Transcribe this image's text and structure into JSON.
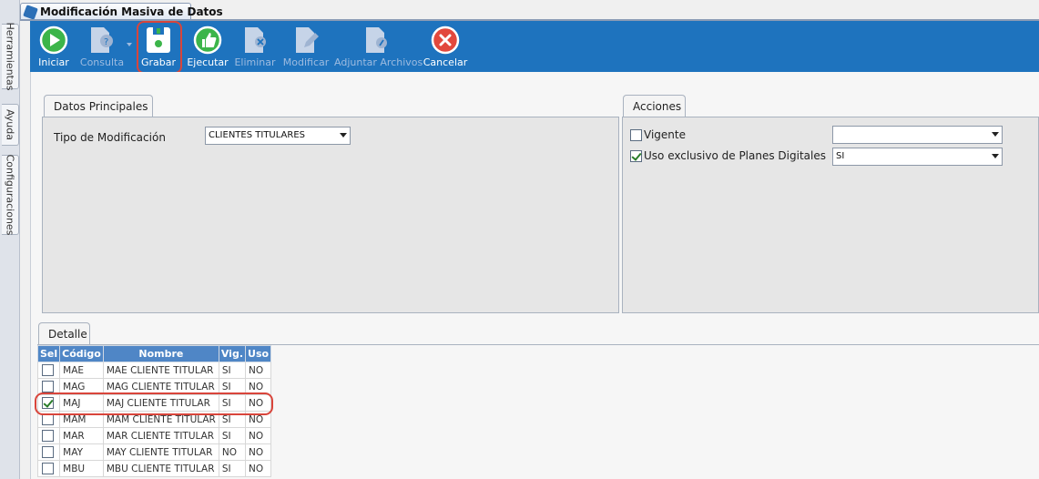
{
  "window": {
    "title": "Modificación Masiva de Datos"
  },
  "side_tabs": [
    "Herramientas",
    "Ayuda",
    "Configuraciones"
  ],
  "toolbar": {
    "buttons": [
      {
        "label": "Iniciar",
        "icon": "play-icon",
        "enabled": true
      },
      {
        "label": "Consulta",
        "icon": "query-document-icon",
        "enabled": false
      },
      {
        "label": "Grabar",
        "icon": "save-icon",
        "enabled": true
      },
      {
        "label": "Ejecutar",
        "icon": "thumbs-up-icon",
        "enabled": true
      },
      {
        "label": "Eliminar",
        "icon": "delete-document-icon",
        "enabled": false
      },
      {
        "label": "Modificar",
        "icon": "edit-document-icon",
        "enabled": false
      },
      {
        "label": "Adjuntar Archivos",
        "icon": "attach-document-icon",
        "enabled": false
      },
      {
        "label": "Cancelar",
        "icon": "cancel-icon",
        "enabled": true
      }
    ]
  },
  "datos_principales": {
    "tab_label": "Datos Principales",
    "tipo_label": "Tipo de Modificación",
    "tipo_value": "CLIENTES TITULARES"
  },
  "acciones": {
    "tab_label": "Acciones",
    "vigente_label": "Vigente",
    "vigente_checked": false,
    "vigente_value": "",
    "uso_label": "Uso exclusivo de Planes Digitales",
    "uso_checked": true,
    "uso_value": "SI"
  },
  "detalle": {
    "tab_label": "Detalle",
    "columns": [
      "Sel",
      "Código",
      "Nombre",
      "Vig.",
      "Uso"
    ],
    "rows": [
      {
        "checked": false,
        "codigo": "MAE",
        "nombre": "MAE CLIENTE TITULAR",
        "vig": "SI",
        "uso": "NO"
      },
      {
        "checked": false,
        "codigo": "MAG",
        "nombre": "MAG CLIENTE TITULAR",
        "vig": "SI",
        "uso": "NO"
      },
      {
        "checked": true,
        "codigo": "MAJ",
        "nombre": "MAJ CLIENTE TITULAR",
        "vig": "SI",
        "uso": "NO"
      },
      {
        "checked": false,
        "codigo": "MAM",
        "nombre": "MAM CLIENTE TITULAR",
        "vig": "SI",
        "uso": "NO"
      },
      {
        "checked": false,
        "codigo": "MAR",
        "nombre": "MAR CLIENTE TITULAR",
        "vig": "SI",
        "uso": "NO"
      },
      {
        "checked": false,
        "codigo": "MAY",
        "nombre": "MAY CLIENTE TITULAR",
        "vig": "NO",
        "uso": "NO"
      },
      {
        "checked": false,
        "codigo": "MBU",
        "nombre": "MBU CLIENTE TITULAR",
        "vig": "SI",
        "uso": "NO"
      }
    ]
  },
  "colors": {
    "toolbar": "#1e73be",
    "grid_header": "#4f86c6",
    "highlight": "#d9453b"
  }
}
